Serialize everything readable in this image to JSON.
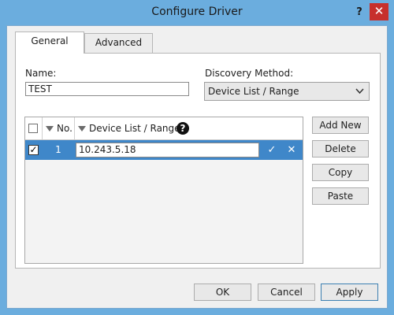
{
  "window": {
    "title": "Configure Driver",
    "help_glyph": "?",
    "close_glyph": "✕"
  },
  "tabs": [
    {
      "label": "General",
      "active": true
    },
    {
      "label": "Advanced",
      "active": false
    }
  ],
  "form": {
    "name_label": "Name:",
    "name_value": "TEST",
    "discovery_label": "Discovery Method:",
    "discovery_value": "Device List / Range"
  },
  "grid": {
    "columns": {
      "no": "No.",
      "range": "Device List / Range"
    },
    "help_glyph": "?",
    "rows": [
      {
        "checked": true,
        "check_glyph": "✓",
        "no": "1",
        "value": "10.243.5.18"
      }
    ],
    "confirm_glyph": "✓",
    "cancel_glyph": "✕"
  },
  "side_buttons": {
    "add_new": "Add New",
    "delete": "Delete",
    "copy": "Copy",
    "paste": "Paste"
  },
  "dialog_buttons": {
    "ok": "OK",
    "cancel": "Cancel",
    "apply": "Apply"
  },
  "colors": {
    "title_bar": "#6badde",
    "close_button": "#c7302c",
    "selected_row": "#3f87c9",
    "dialog_face": "#f0f0f0"
  },
  "icons": {
    "help": "question-mark-icon",
    "close": "close-icon",
    "dropdown": "chevron-down-icon",
    "sort": "triangle-down-icon",
    "info": "question-circle-icon",
    "confirm": "checkmark-icon",
    "cancel": "x-icon"
  }
}
